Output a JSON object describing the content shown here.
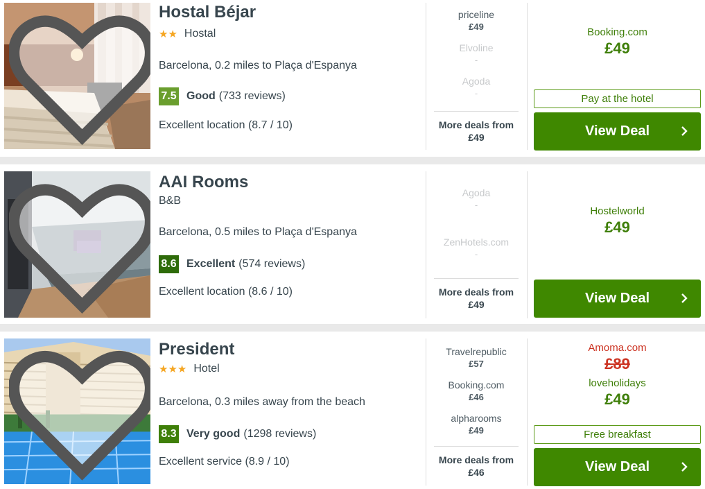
{
  "hotels": [
    {
      "name": "Hostal Béjar",
      "stars": "★★",
      "type": "Hostal",
      "location": "Barcelona, 0.2 miles to Plaça d'Espanya",
      "score": "7.5",
      "score_color": "#6a9e2e",
      "rating_label": "Good",
      "reviews": "(733 reviews)",
      "extra": "Excellent location (8.7 / 10)",
      "deals": [
        {
          "provider": "priceline",
          "price": "£49",
          "available": true
        },
        {
          "provider": "Elvoline",
          "price": "-",
          "available": false
        },
        {
          "provider": "Agoda",
          "price": "-",
          "available": false
        }
      ],
      "more_label": "More deals from",
      "more_price": "£49",
      "best_provider": "Booking.com",
      "best_price": "£49",
      "tag": "Pay at the hotel",
      "button": "View Deal"
    },
    {
      "name": "AAI Rooms",
      "stars": "",
      "type": "B&B",
      "location": "Barcelona, 0.5 miles to Plaça d'Espanya",
      "score": "8.6",
      "score_color": "#2e6b0a",
      "rating_label": "Excellent",
      "reviews": "(574 reviews)",
      "extra": "Excellent location (8.6 / 10)",
      "deals": [
        {
          "provider": "Agoda",
          "price": "-",
          "available": false
        },
        {
          "provider": "ZenHotels.com",
          "price": "-",
          "available": false
        }
      ],
      "more_label": "More deals from",
      "more_price": "£49",
      "best_provider": "Hostelworld",
      "best_price": "£49",
      "tag": "",
      "button": "View Deal"
    },
    {
      "name": "President",
      "stars": "★★★",
      "type": "Hotel",
      "location": "Barcelona, 0.3 miles away from the beach",
      "score": "8.3",
      "score_color": "#3f7f09",
      "rating_label": "Very good",
      "reviews": "(1298 reviews)",
      "extra": "Excellent service (8.9 / 10)",
      "deals": [
        {
          "provider": "Travelrepublic",
          "price": "£57",
          "available": true
        },
        {
          "provider": "Booking.com",
          "price": "£46",
          "available": true
        },
        {
          "provider": "alpharooms",
          "price": "£49",
          "available": true
        }
      ],
      "more_label": "More deals from",
      "more_price": "£46",
      "old_provider": "Amoma.com",
      "old_price": "£89",
      "best_provider": "loveholidays",
      "best_price": "£49",
      "tag": "Free breakfast",
      "button": "View Deal"
    }
  ],
  "colors": {
    "accent": "#3f8800",
    "brand_green": "#3f7f09",
    "star": "#f5a623",
    "strike_red": "#cc3322"
  },
  "icons": {
    "favourite": "heart-icon",
    "button_arrow": "chevron-right-icon"
  }
}
